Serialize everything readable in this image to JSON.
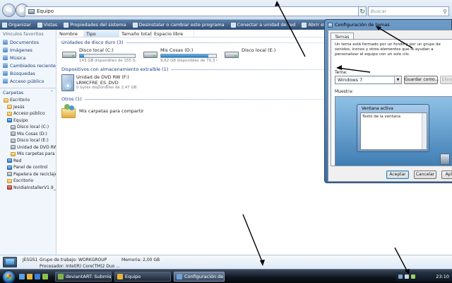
{
  "explorer": {
    "path": "Equipo",
    "search_placeholder": "Buscar",
    "toolbar": [
      {
        "label": "Organizar",
        "icon": "organize-icon"
      },
      {
        "label": "Vistas",
        "icon": "views-icon"
      },
      {
        "label": "Propiedades del sistema",
        "icon": "system-properties-icon"
      },
      {
        "label": "Desinstalar o cambiar este programa",
        "icon": "uninstall-icon"
      },
      {
        "label": "Conectar a unidad de red",
        "icon": "network-drive-icon"
      },
      {
        "label": "Abrir el Panel de control",
        "icon": "control-panel-icon"
      }
    ],
    "columns": [
      "Nombre",
      "Tipo",
      "Tamaño total",
      "Espacio libre"
    ],
    "nav": {
      "favorites_label": "Vínculos favoritos",
      "favorites": [
        "Documentos",
        "Imágenes",
        "Música",
        "Cambiados recientemente",
        "Búsquedas",
        "Acceso público"
      ],
      "folders_label": "Carpetas",
      "tree": [
        {
          "label": "Escritorio",
          "indent": 1,
          "icon": "folder"
        },
        {
          "label": "Jesús",
          "indent": 2,
          "icon": "folder"
        },
        {
          "label": "Acceso público",
          "indent": 2,
          "icon": "folder"
        },
        {
          "label": "Equipo",
          "indent": 2,
          "icon": "blue"
        },
        {
          "label": "Disco local (C:)",
          "indent": 3,
          "icon": "drive"
        },
        {
          "label": "Mis Cosas (D:)",
          "indent": 3,
          "icon": "drive"
        },
        {
          "label": "Disco local (E:)",
          "indent": 3,
          "icon": "drive"
        },
        {
          "label": "Unidad de DVD RW",
          "indent": 3,
          "icon": "drive"
        },
        {
          "label": "Mis carpetas para compartir",
          "indent": 3,
          "icon": "folder"
        },
        {
          "label": "Red",
          "indent": 2,
          "icon": "blue"
        },
        {
          "label": "Panel de control",
          "indent": 2,
          "icon": "blue"
        },
        {
          "label": "Papelera de reciclaje",
          "indent": 2,
          "icon": "drive"
        },
        {
          "label": "Escritorio",
          "indent": 2,
          "icon": "folder"
        },
        {
          "label": "NvidiaInstallerV1.9_",
          "indent": 2,
          "icon": "red"
        }
      ]
    },
    "groups": {
      "hdd_title": "Unidades de disco duro (3)",
      "removable_title": "Dispositivos con almacenamiento extraíble (1)",
      "other_title": "Otros (1)"
    },
    "drives": [
      {
        "name": "Disco local (C:)",
        "free": "143 GB disponibles de 155 GB",
        "used_fraction": 0.08
      },
      {
        "name": "Mis Cosas (D:)",
        "free": "9,62 GB disponibles de 70,3 GB",
        "used_fraction": 0.86
      },
      {
        "name": "Disco local (E:)",
        "free": "",
        "used_fraction": null
      }
    ],
    "dvd": {
      "name": "Unidad de DVD RW (F:)",
      "label": "LRMCFRE_ES_DVD",
      "free": "0 bytes disponibles de 2,47 GB"
    },
    "other": {
      "name": "Mis carpetas para compartir"
    },
    "details": {
      "computer_name": "JESÚS1",
      "workgroup": "Grupo de trabajo: WORKGROUP",
      "memory": "Memoria: 2,00 GB",
      "processor": "Procesador: Intel(R) Core(TM)2 Duo ..."
    }
  },
  "dialog": {
    "title": "Configuración de temas",
    "tab": "Temas",
    "description": "Un tema está formado por un fondo y por un grupo de sonidos, iconos y otros elementos que le ayudan a personalizar el equipo con un solo clic.",
    "theme_label": "Tema:",
    "theme_value": "Windows 7",
    "save_as": "Guardar como...",
    "delete": "Eliminar",
    "preview_label": "Muestra:",
    "preview_window_title": "Ventana activa",
    "preview_window_text": "Texto de la ventana",
    "ok": "Aceptar",
    "cancel": "Cancelar",
    "apply": "Aplicar"
  },
  "taskbar": {
    "tasks": [
      {
        "label": "deviantART: Submis...",
        "active": false
      },
      {
        "label": "Equipo",
        "active": false
      },
      {
        "label": "Configuración de te...",
        "active": true
      }
    ],
    "clock": "23:10"
  },
  "colors": {
    "toolbar": "#2f4d75",
    "link_text": "#1a3d73",
    "group_title": "#1e3a8a",
    "meter_fill": "#1e7ec8",
    "dialog_frame": "#3f6f9f"
  }
}
